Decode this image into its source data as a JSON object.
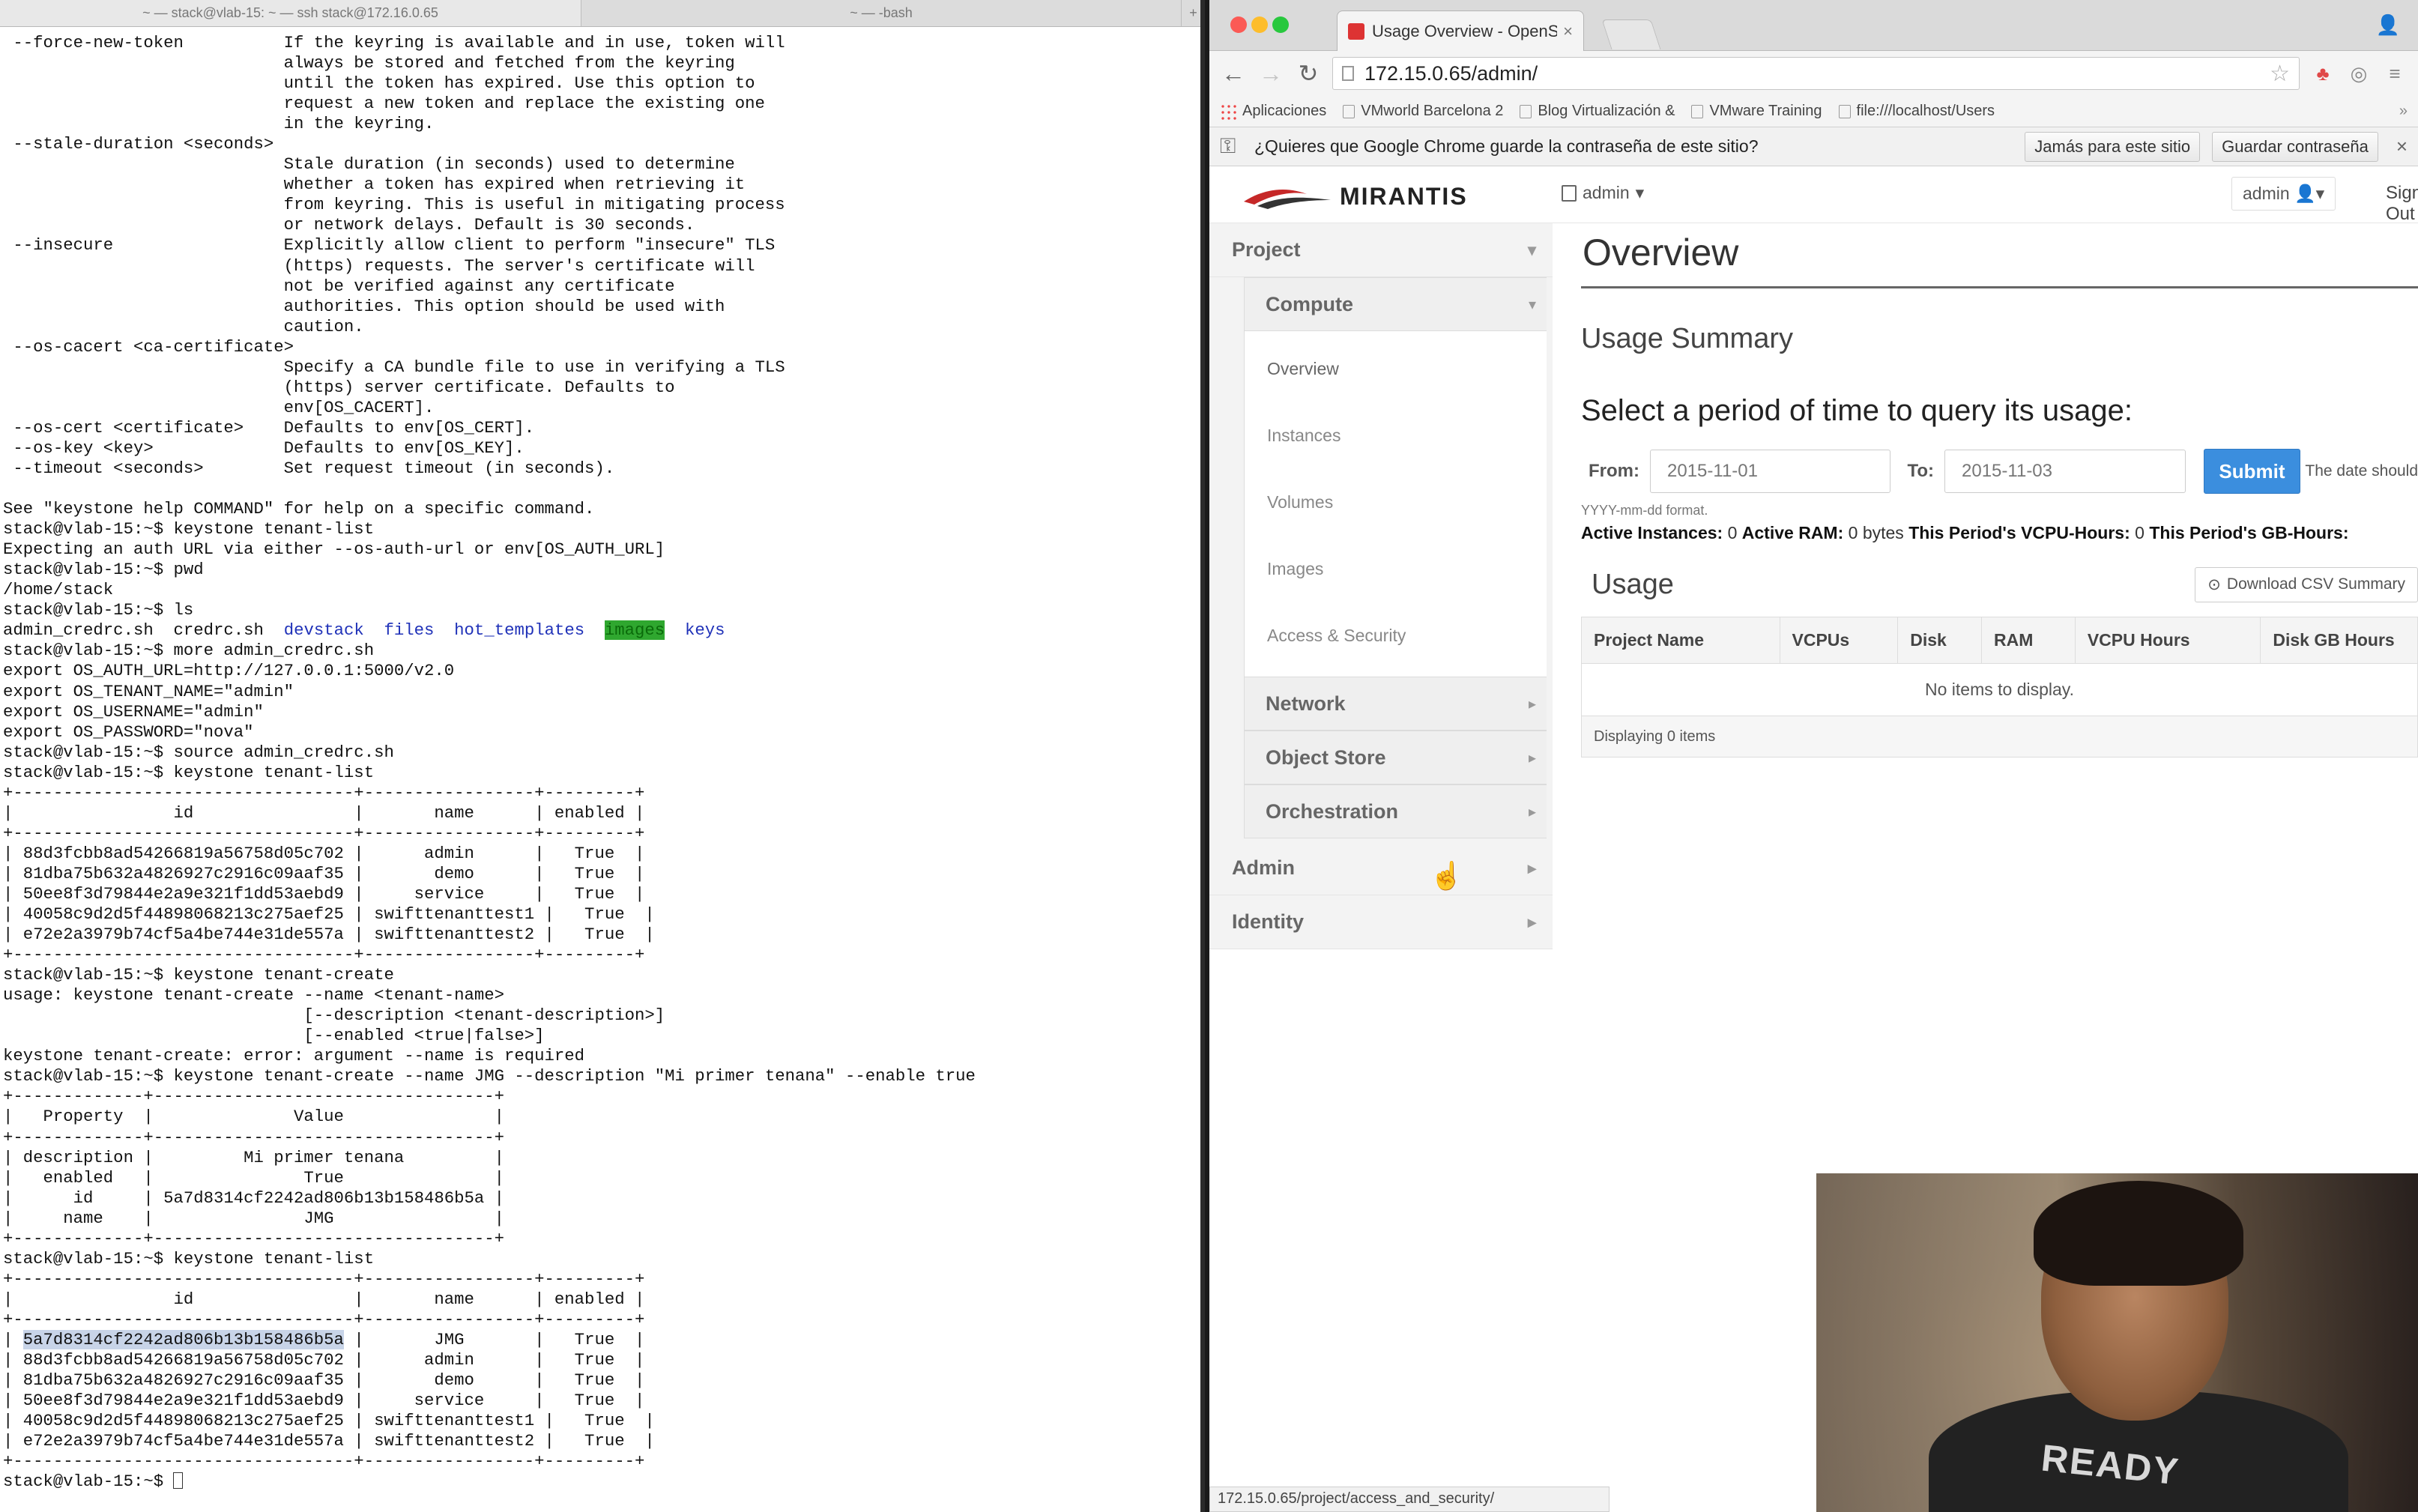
{
  "terminal": {
    "tab1": "~ — stack@vlab-15: ~ — ssh stack@172.16.0.65",
    "tab2": "~ — -bash",
    "tab_add": "+",
    "lines": [
      " --force-new-token          If the keyring is available and in use, token will",
      "                            always be stored and fetched from the keyring",
      "                            until the token has expired. Use this option to",
      "                            request a new token and replace the existing one",
      "                            in the keyring.",
      " --stale-duration <seconds>",
      "                            Stale duration (in seconds) used to determine",
      "                            whether a token has expired when retrieving it",
      "                            from keyring. This is useful in mitigating process",
      "                            or network delays. Default is 30 seconds.",
      " --insecure                 Explicitly allow client to perform \"insecure\" TLS",
      "                            (https) requests. The server's certificate will",
      "                            not be verified against any certificate",
      "                            authorities. This option should be used with",
      "                            caution.",
      " --os-cacert <ca-certificate>",
      "                            Specify a CA bundle file to use in verifying a TLS",
      "                            (https) server certificate. Defaults to",
      "                            env[OS_CACERT].",
      " --os-cert <certificate>    Defaults to env[OS_CERT].",
      " --os-key <key>             Defaults to env[OS_KEY].",
      " --timeout <seconds>        Set request timeout (in seconds).",
      "",
      "See \"keystone help COMMAND\" for help on a specific command.",
      "stack@vlab-15:~$ keystone tenant-list",
      "Expecting an auth URL via either --os-auth-url or env[OS_AUTH_URL]",
      "stack@vlab-15:~$ pwd",
      "/home/stack",
      "stack@vlab-15:~$ ls",
      "__LS__",
      "stack@vlab-15:~$ more admin_credrc.sh",
      "export OS_AUTH_URL=http://127.0.0.1:5000/v2.0",
      "export OS_TENANT_NAME=\"admin\"",
      "export OS_USERNAME=\"admin\"",
      "export OS_PASSWORD=\"nova\"",
      "stack@vlab-15:~$ source admin_credrc.sh",
      "stack@vlab-15:~$ keystone tenant-list",
      "+----------------------------------+-----------------+---------+",
      "|                id                |       name      | enabled |",
      "+----------------------------------+-----------------+---------+",
      "| 88d3fcbb8ad54266819a56758d05c702 |      admin      |   True  |",
      "| 81dba75b632a4826927c2916c09aaf35 |       demo      |   True  |",
      "| 50ee8f3d79844e2a9e321f1dd53aebd9 |     service     |   True  |",
      "| 40058c9d2d5f44898068213c275aef25 | swifttenanttest1 |   True  |",
      "| e72e2a3979b74cf5a4be744e31de557a | swifttenanttest2 |   True  |",
      "+----------------------------------+-----------------+---------+",
      "stack@vlab-15:~$ keystone tenant-create",
      "usage: keystone tenant-create --name <tenant-name>",
      "                              [--description <tenant-description>]",
      "                              [--enabled <true|false>]",
      "keystone tenant-create: error: argument --name is required",
      "stack@vlab-15:~$ keystone tenant-create --name JMG --description \"Mi primer tenana\" --enable true",
      "+-------------+----------------------------------+",
      "|   Property  |              Value               |",
      "+-------------+----------------------------------+",
      "| description |         Mi primer tenana         |",
      "|   enabled   |               True               |",
      "|      id     | 5a7d8314cf2242ad806b13b158486b5a |",
      "|     name    |               JMG                |",
      "+-------------+----------------------------------+",
      "stack@vlab-15:~$ keystone tenant-list",
      "+----------------------------------+-----------------+---------+",
      "|                id                |       name      | enabled |",
      "+----------------------------------+-----------------+---------+",
      "__SEL__",
      "| 88d3fcbb8ad54266819a56758d05c702 |      admin      |   True  |",
      "| 81dba75b632a4826927c2916c09aaf35 |       demo      |   True  |",
      "| 50ee8f3d79844e2a9e321f1dd53aebd9 |     service     |   True  |",
      "| 40058c9d2d5f44898068213c275aef25 | swifttenanttest1 |   True  |",
      "| e72e2a3979b74cf5a4be744e31de557a | swifttenanttest2 |   True  |",
      "+----------------------------------+-----------------+---------+",
      "__PROMPT__"
    ],
    "ls_output": {
      "plain": [
        "admin_credrc.sh",
        "credrc.sh"
      ],
      "dirs": [
        "devstack",
        "files",
        "hot_templates"
      ],
      "highlighted": "images",
      "last_dir": "keys"
    },
    "selected_row": {
      "pre": "| ",
      "id": "5a7d8314cf2242ad806b13b158486b5a",
      "post": " |       JMG       |   True  |"
    },
    "prompt": "stack@vlab-15:~$ "
  },
  "browser": {
    "tab_title": "Usage Overview - OpenStack",
    "tab_close": "×",
    "url": "172.15.0.65/admin/",
    "bookmarks": [
      "Aplicaciones",
      "VMworld Barcelona 2",
      "Blog Virtualización &",
      "VMware Training",
      "file:///localhost/Users"
    ],
    "bookmarks_more": "»",
    "infobar": {
      "text": "¿Quieres que Google Chrome guarde la contraseña de este sitio?",
      "never": "Jamás para este sitio",
      "save": "Guardar contraseña",
      "close": "×"
    },
    "status_url": "172.15.0.65/project/access_and_security/"
  },
  "horizon": {
    "logo": "MIRANTIS",
    "project_switch": "admin",
    "user_menu": "admin",
    "signout": "Sign Out",
    "sidebar": {
      "project": "Project",
      "compute": "Compute",
      "compute_items": [
        "Overview",
        "Instances",
        "Volumes",
        "Images",
        "Access & Security"
      ],
      "network": "Network",
      "object_store": "Object Store",
      "orchestration": "Orchestration",
      "admin": "Admin",
      "identity": "Identity"
    },
    "page_title": "Overview",
    "usage_summary": "Usage Summary",
    "period_title": "Select a period of time to query its usage:",
    "from_label": "From:",
    "from_value": "2015-11-01",
    "to_label": "To:",
    "to_value": "2015-11-03",
    "submit": "Submit",
    "date_hint": "The date should",
    "format_hint": "YYYY-mm-dd format.",
    "totals": {
      "active_instances_label": "Active Instances:",
      "active_instances": "0",
      "active_ram_label": "Active RAM:",
      "active_ram": "0 bytes",
      "vcpu_hours_label": "This Period's VCPU-Hours:",
      "vcpu_hours": "0",
      "gb_hours_label": "This Period's GB-Hours:"
    },
    "usage_title": "Usage",
    "csv_button": "Download CSV Summary",
    "table_columns": [
      "Project Name",
      "VCPUs",
      "Disk",
      "RAM",
      "VCPU Hours",
      "Disk GB Hours"
    ],
    "empty_message": "No items to display.",
    "footer": "Displaying 0 items"
  },
  "webcam": {
    "shirt_text": "READY"
  },
  "colors": {
    "submit_blue": "#3b8ede",
    "terminal_dir_blue": "#1f31b8",
    "terminal_highlight_green": "#2fa72f"
  }
}
